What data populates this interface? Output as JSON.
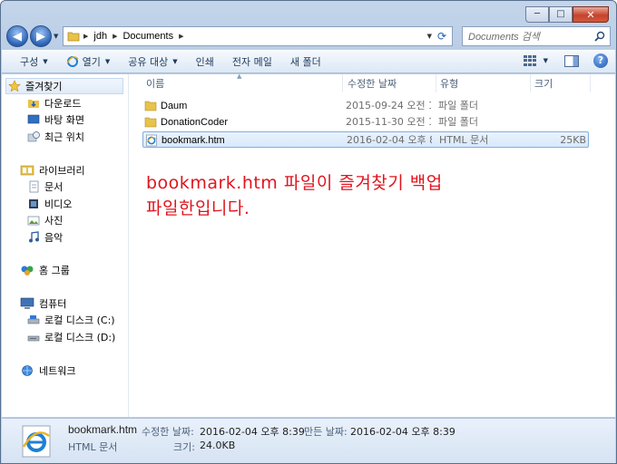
{
  "window": {
    "controls": {
      "minimize": "─",
      "maximize": "□",
      "close": "✕"
    }
  },
  "address": {
    "crumbs": [
      "jdh",
      "Documents"
    ],
    "search_placeholder": "Documents 검색"
  },
  "toolbar": {
    "organize": "구성",
    "open": "열기",
    "share": "공유 대상",
    "print": "인쇄",
    "email": "전자 메일",
    "new_folder": "새 폴더"
  },
  "nav": {
    "favorites": "즐겨찾기",
    "downloads": "다운로드",
    "desktop": "바탕 화면",
    "recent": "최근 위치",
    "libraries": "라이브러리",
    "documents": "문서",
    "videos": "비디오",
    "pictures": "사진",
    "music": "음악",
    "homegroup": "홈 그룹",
    "computer": "컴퓨터",
    "local_c": "로컬 디스크 (C:)",
    "local_d": "로컬 디스크 (D:)",
    "network": "네트워크"
  },
  "columns": {
    "name": "이름",
    "date": "수정한 날짜",
    "type": "유형",
    "size": "크기"
  },
  "files": [
    {
      "name": "Daum",
      "date": "2015-09-24 오전 1...",
      "type": "파일 폴더",
      "size": ""
    },
    {
      "name": "DonationCoder",
      "date": "2015-11-30 오전 1...",
      "type": "파일 폴더",
      "size": ""
    },
    {
      "name": "bookmark.htm",
      "date": "2016-02-04 오후 8...",
      "type": "HTML 문서",
      "size": "25KB"
    }
  ],
  "annotation": {
    "line1": "bookmark.htm 파일이 즐겨찾기 백업",
    "line2": "파일한입니다."
  },
  "details": {
    "name": "bookmark.htm",
    "type": "HTML 문서",
    "modified_label": "수정한 날짜:",
    "modified_value": "2016-02-04 오후 8:39",
    "created_label": "만든 날짜:",
    "created_value": "2016-02-04 오후 8:39",
    "size_label": "크기:",
    "size_value": "24.0KB"
  },
  "icons": {
    "back": "arrow-left-icon",
    "forward": "arrow-right-icon",
    "refresh": "refresh-icon",
    "search": "search-icon",
    "folder": "folder-icon",
    "ie": "internet-explorer-icon"
  },
  "colors": {
    "annotation": "#e0141e",
    "selection": "#d8e8fb",
    "folder": "#e8c24a"
  }
}
